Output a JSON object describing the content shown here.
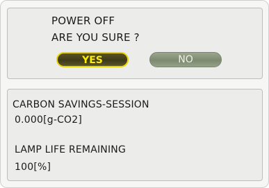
{
  "confirm": {
    "line1": "POWER OFF",
    "line2": "ARE YOU SURE ?",
    "yes_label": "YES",
    "no_label": "NO"
  },
  "info": {
    "carbon_label": "CARBON SAVINGS-SESSION",
    "carbon_value": "0.000[g-CO2]",
    "lamp_label": "LAMP LIFE REMAINING",
    "lamp_value": "100[%]"
  },
  "colors": {
    "selected_button_text": "#ffef00",
    "selected_button_border": "#e8d400",
    "unselected_button": "#7d8a70"
  }
}
